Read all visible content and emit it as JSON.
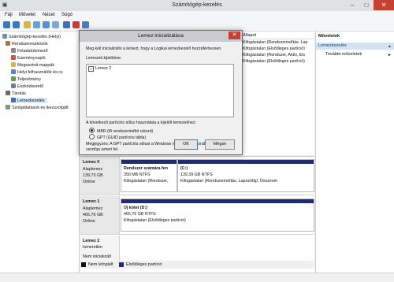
{
  "window": {
    "title": "Számítógép-kezelés",
    "minimize": "–",
    "maximize": "□",
    "close": "✕"
  },
  "menu": [
    "Fájl",
    "Művelet",
    "Nézet",
    "Súgó"
  ],
  "colors": {
    "partition_bar": "#1e2a7c",
    "unallocated": "#111111",
    "accent": "#0d5fb5",
    "close_red": "#c84031"
  },
  "tree": {
    "root": "Számítógép-kezelés (Helyi)",
    "system_tools": "Rendszereszközök",
    "task_scheduler": "Feladatütemező",
    "event_viewer": "Eseménynapló",
    "shared_folders": "Megosztott mappák",
    "local_users": "Helyi felhasználók és cs",
    "performance": "Teljesítmény",
    "device_manager": "Eszközkezelő",
    "storage": "Tárolás",
    "disk_management": "Lemezkezelés",
    "services": "Szolgáltatások és lkezszolgált"
  },
  "volume_list": {
    "status_header": "Állapot",
    "rows": [
      "Kifogástalan (Rendszerindítás, Lap",
      "Kifogástalan (Elsődleges partíció)",
      "Kifogástalan (Rendszer, Aktív, Els",
      "Kifogástalan (Elsődleges partíció)"
    ]
  },
  "actions": {
    "header": "Műveletek",
    "section": "Lemezkezelés",
    "more": "További műveletek"
  },
  "disks": [
    {
      "name": "Lemez 0",
      "type": "Alaplemez",
      "size": "139,73 GB",
      "state": "Online",
      "partitions": [
        {
          "name": "Rendszer számára fen",
          "size": "350 MB NTFS",
          "status": "Kifogástalan (Rendszer, "
        },
        {
          "name": "(C:)",
          "size": "139,39 GB NTFS",
          "status": "Kifogástalan (Rendszerindítás, Lapozófájl, Összeom"
        }
      ]
    },
    {
      "name": "Lemez 1",
      "type": "Alaplemez",
      "size": "465,76 GB",
      "state": "Online",
      "partitions": [
        {
          "name": "Új kötet  (D:)",
          "size": "465,76 GB NTFS",
          "status": "Kifogástalan (Elsődleges partíció)"
        }
      ]
    },
    {
      "name": "Lemez 2",
      "type": "Ismeretlen",
      "size": "",
      "state": "Nem inicializált",
      "partitions": []
    }
  ],
  "legend": {
    "unallocated": "Nem lefoglalt",
    "primary": "Elsődleges partíció"
  },
  "dialog": {
    "title": "Lemez inicializálása",
    "intro": "Meg kell inicializálni a lemezt, hogy a Logikai lemezkezelő hozzáférhessen.",
    "select_label": "Lemezek kijelölése:",
    "disk_item": "Lemez 2",
    "style_label": "A következő partíciós stílus használata a kijelölt lemezekhez:",
    "mbr": "MBR (fő rendszerindító rekord)",
    "gpt": "GPT (GUID partíciós tábla)",
    "note_1": "Megjegyzés: A GPT partíciós stílust a Windows nem minden korábbi",
    "note_2": "verziója ismeri fel.",
    "ok": "OK",
    "cancel": "Mégse"
  }
}
